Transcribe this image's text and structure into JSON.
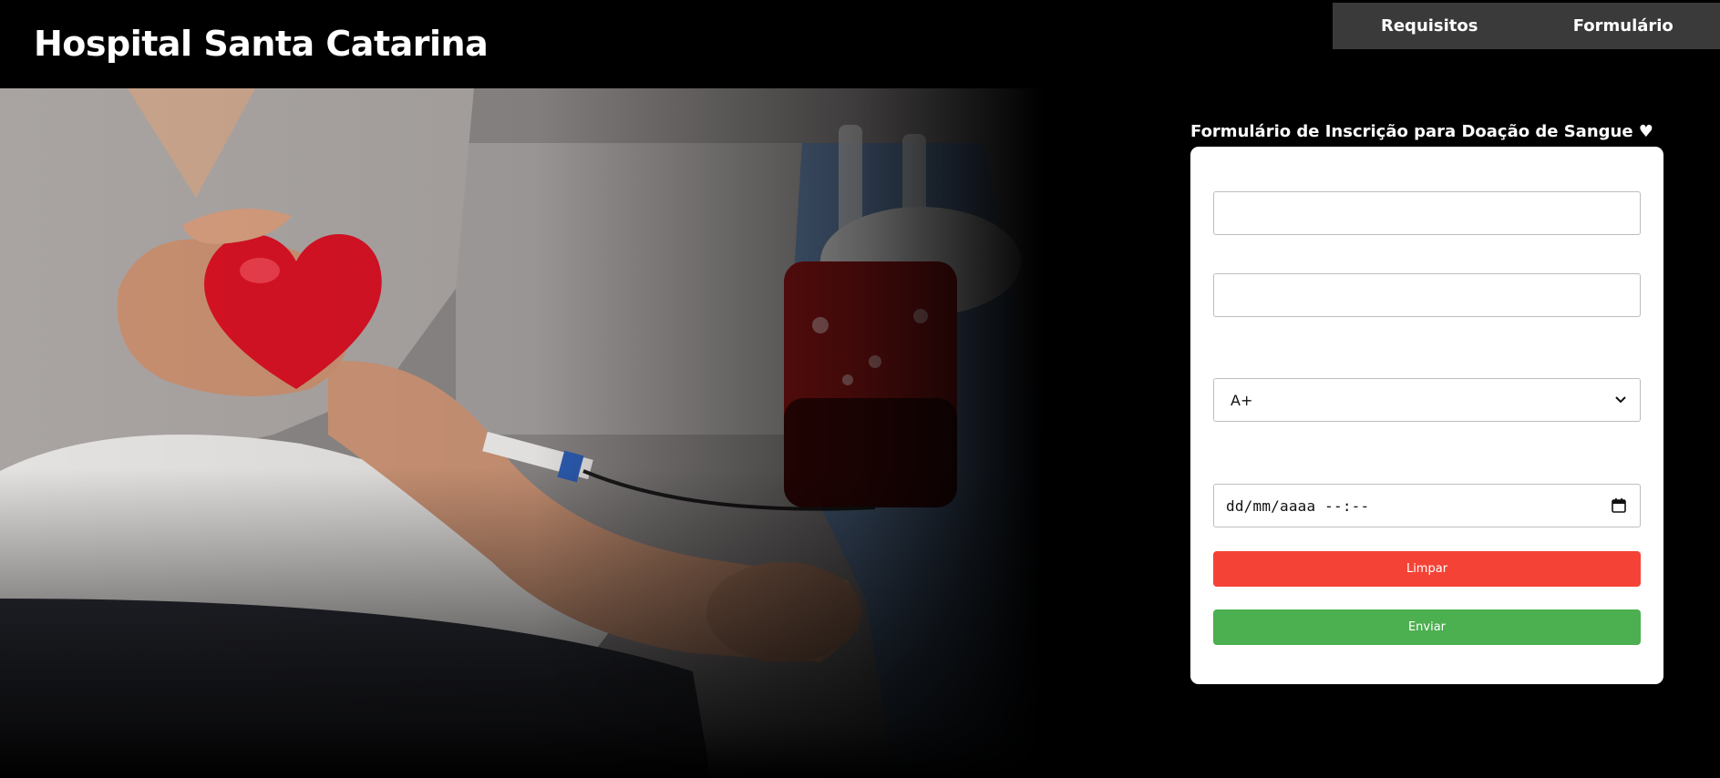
{
  "header": {
    "title": "Hospital Santa Catarina",
    "nav": [
      {
        "label": "Requisitos"
      },
      {
        "label": "Formulário"
      }
    ]
  },
  "form": {
    "heading": "Formulário de Inscrição para Doação de Sangue ♥",
    "name_value": "",
    "email_value": "",
    "blood_type": {
      "selected": "A+",
      "options": [
        "A+"
      ]
    },
    "datetime_placeholder": "dd/mm/aaaa --:--",
    "clear_label": "Limpar",
    "submit_label": "Enviar"
  },
  "colors": {
    "nav_bg": "#3a3a3a",
    "clear_button": "#f44336",
    "submit_button": "#4caf50",
    "card_bg": "#ffffff",
    "page_bg": "#000000"
  },
  "icons": {
    "select": "chevron-down-icon",
    "datetime": "calendar-icon"
  }
}
